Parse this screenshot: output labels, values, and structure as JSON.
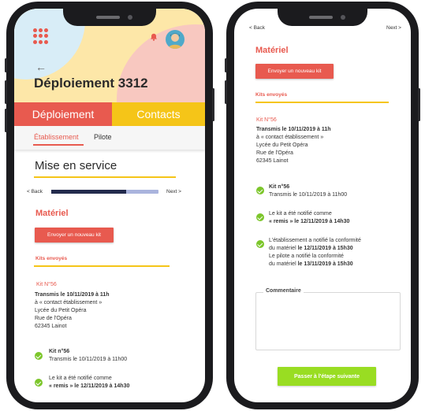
{
  "left": {
    "header": {
      "title": "Déploiement 3312",
      "back_icon": "←",
      "menu_icon": "grid-icon",
      "bell_icon": "bell-icon"
    },
    "tabs": [
      {
        "label": "Déploiement",
        "color": "#e85a4f"
      },
      {
        "label": "Contacts",
        "color": "#f5c518"
      }
    ],
    "subtabs": [
      {
        "label": "Établissement",
        "active": true
      },
      {
        "label": "Pilote",
        "active": false
      }
    ],
    "section_title": "Mise en service",
    "nav": {
      "back": "< Back",
      "next": "Next >",
      "progress": 0.7
    },
    "materiel": {
      "title": "Matériel",
      "button": "Envoyer un nouveau kit",
      "kits_sent": "Kits envoyés"
    },
    "kit": {
      "label": "Kit N°56",
      "transmitted": "Transmis le 10/11/2019 à 11h",
      "to": "à « contact établissement »",
      "address": [
        "Lycée du Petit Opéra",
        "Rue de l'Opéra",
        "62345 Lainot"
      ]
    },
    "events": [
      {
        "title": "Kit n°56",
        "line1": "Transmis le 10/11/2019 à 11h00"
      },
      {
        "line1": "Le kit a été notifié comme",
        "line2": "« remis » le 12/11/2019 à 14h30"
      }
    ]
  },
  "right": {
    "nav": {
      "back": "< Back",
      "next": "Next >"
    },
    "materiel": {
      "title": "Matériel",
      "button": "Envoyer un nouveau kit",
      "kits_sent": "Kits envoyés"
    },
    "kit": {
      "label": "Kit N°56",
      "transmitted": "Transmis le 10/11/2019 à 11h",
      "to": "à « contact établissement »",
      "address": [
        "Lycée du Petit Opéra",
        "Rue de l'Opéra",
        "62345 Lainot"
      ]
    },
    "events": [
      {
        "title": "Kit n°56",
        "line1": "Transmis le 10/11/2019 à 11h00"
      },
      {
        "line1": "Le kit a été notifié comme",
        "line2": "« remis » le 12/11/2019 à 14h30"
      },
      {
        "line1": "L'établissement a notifié la conformité",
        "line2": "du matériel le 12/11/2019 à 15h30",
        "line3": "Le pilote a notifié la conformité",
        "line4": "du matériel le 13/11/2019 à 15h30"
      }
    ],
    "comment_label": "Commentaire",
    "next_step_button": "Passer à l'étape suivante"
  },
  "colors": {
    "accent_red": "#e85a4f",
    "accent_yellow": "#f5c518",
    "accent_green": "#99dd22",
    "check_green": "#7cc62b",
    "navy": "#232b4d"
  }
}
